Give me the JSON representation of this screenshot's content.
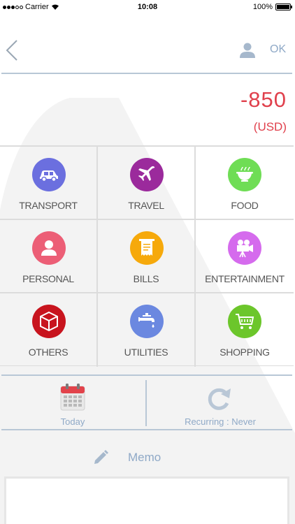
{
  "status_bar": {
    "carrier": "Carrier",
    "time": "10:08",
    "battery": "100%",
    "battery_level": 1.0
  },
  "nav": {
    "ok_label": "OK"
  },
  "amount": {
    "value": "-850",
    "currency": "(USD)",
    "color": "#e0404c"
  },
  "categories": [
    {
      "label": "TRANSPORT",
      "icon": "car-icon",
      "color": "#6b6fdf"
    },
    {
      "label": "TRAVEL",
      "icon": "airplane-icon",
      "color": "#9b2a9c"
    },
    {
      "label": "FOOD",
      "icon": "food-bowl-icon",
      "color": "#6fdd55"
    },
    {
      "label": "PERSONAL",
      "icon": "person-icon",
      "color": "#ec5e76"
    },
    {
      "label": "BILLS",
      "icon": "receipt-icon",
      "color": "#f6a90b"
    },
    {
      "label": "ENTERTAINMENT",
      "icon": "movie-camera-icon",
      "color": "#d56bed"
    },
    {
      "label": "OTHERS",
      "icon": "box-icon",
      "color": "#c8141e"
    },
    {
      "label": "UTILITIES",
      "icon": "faucet-icon",
      "color": "#6b88e0"
    },
    {
      "label": "SHOPPING",
      "icon": "cart-icon",
      "color": "#6cc62b"
    }
  ],
  "options": {
    "date_label": "Today",
    "recurring_label": "Recurring : Never"
  },
  "memo": {
    "label": "Memo"
  },
  "colors": {
    "accent": "#8fa9c7",
    "divider": "#b8c7d6"
  }
}
